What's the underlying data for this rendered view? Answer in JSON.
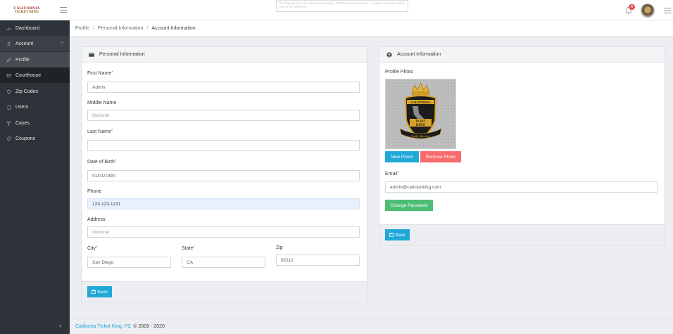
{
  "header": {
    "logo_line1": "CALIFORNIA",
    "logo_line2": "TICKET KING",
    "dev_tooltip": "Sending Referrer for Applicant findings - Pathfinding Developers - multiple trimmed entries (link to be resolved)",
    "notification_count": "4"
  },
  "sidebar": {
    "items": [
      {
        "label": "Dashboard",
        "icon": "chart-icon"
      },
      {
        "label": "Account",
        "icon": "person-icon"
      },
      {
        "label": "Profile",
        "icon": "pencil-icon"
      },
      {
        "label": "Courthouse",
        "icon": "building-icon"
      },
      {
        "label": "Zip Codes",
        "icon": "location-icon"
      },
      {
        "label": "Users",
        "icon": "phone-icon"
      },
      {
        "label": "Cases",
        "icon": "glass-icon"
      },
      {
        "label": "Coupons",
        "icon": "tag-icon"
      }
    ]
  },
  "breadcrumb": {
    "items": [
      "Profile",
      "Personal Information",
      "Account Information"
    ]
  },
  "personal": {
    "title": "Personal Information",
    "first_name_label": "First Name",
    "first_name_value": "Admin",
    "middle_name_label": "Middle Name",
    "middle_name_placeholder": "Optional",
    "last_name_label": "Last Name",
    "last_name_value": "-",
    "dob_label": "Date of Birth",
    "dob_value": "01/01/1990",
    "phone_label": "Phone",
    "phone_value": "123-123-1231",
    "address_label": "Address",
    "address_placeholder": "Optional",
    "city_label": "City",
    "city_value": "San Diego",
    "state_label": "State",
    "state_value": "CA",
    "zip_label": "Zip",
    "zip_value": "92110",
    "save_label": "Save",
    "required_mark": "*"
  },
  "account": {
    "title": "Account Information",
    "photo_label": "Profile Photo",
    "badge_top": "CALIFORNIA",
    "badge_mid1": "TICKET",
    "badge_mid2": "KING",
    "badge_bottom": "Traffic Attorneys",
    "new_photo_label": "New Photo",
    "remove_photo_label": "Remove Photo",
    "email_label": "Email",
    "email_value": "admin@caticketking.com",
    "change_password_label": "Change Password",
    "save_label": "Save"
  },
  "footer": {
    "company": "California Ticket King, PC",
    "copyright": "© 2009 - 2020"
  },
  "colors": {
    "sidebar_bg": "#2e3339",
    "primary": "#20a8d8",
    "danger": "#f86c6b",
    "success": "#4dbd74"
  }
}
